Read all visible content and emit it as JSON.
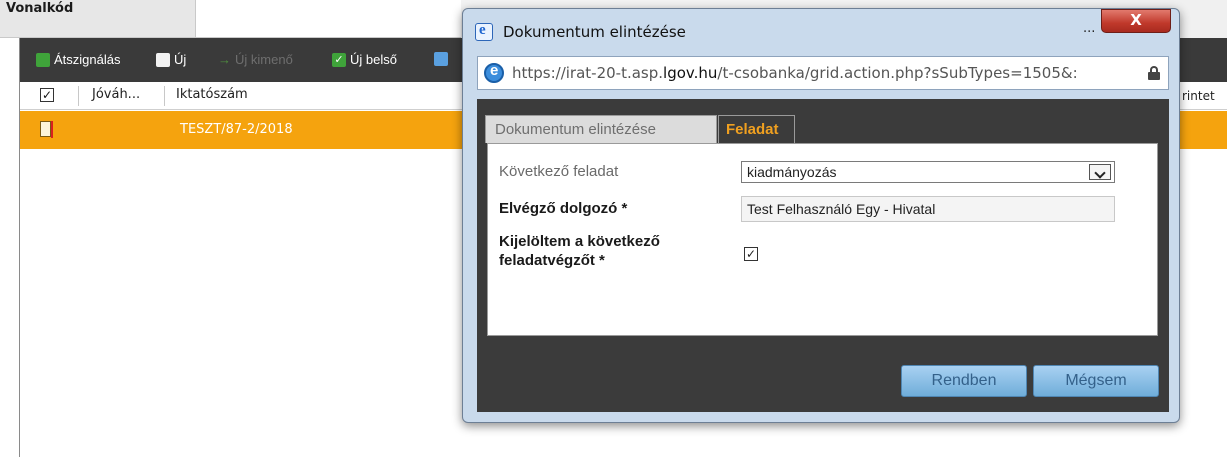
{
  "app": {
    "tab_title": "Vonalkód",
    "toolbar": {
      "items": [
        {
          "label": "Átszignálás",
          "icon": "reassign-icon",
          "enabled": true
        },
        {
          "label": "Új",
          "icon": "new-document-icon",
          "enabled": true
        },
        {
          "label": "Új kimenő",
          "icon": "outgoing-arrow-icon",
          "enabled": false
        },
        {
          "label": "Új belső",
          "icon": "check-icon",
          "enabled": true
        }
      ]
    },
    "grid": {
      "columns": [
        "Jóváh...",
        "Iktatószám"
      ],
      "right_column_fragment": "rintet",
      "rows": [
        {
          "iktatoszam": "TESZT/87-2/2018",
          "selected": true
        }
      ]
    }
  },
  "dialog": {
    "title": "Dokumentum elintézése",
    "title_dots": "...",
    "close_glyph": "X",
    "url_prefix": "https://irat-20-t.asp.",
    "url_domain": "lgov.hu",
    "url_suffix": "/t-csobanka/grid.action.php?sSubTypes=1505&:",
    "tabs": [
      {
        "label": "Dokumentum elintézése",
        "active": false
      },
      {
        "label": "Feladat",
        "active": true
      }
    ],
    "form": {
      "next_task_label": "Következő feladat",
      "next_task_value": "kiadmányozás",
      "assignee_label": "Elvégző dolgozó *",
      "assignee_value": "Test Felhasználó Egy - Hivatal",
      "selected_next_label_line1": "Kijelöltem a következő",
      "selected_next_label_line2": "feladatvégzőt *",
      "selected_next_checked": true
    },
    "buttons": {
      "ok": "Rendben",
      "cancel": "Mégsem"
    }
  },
  "colors": {
    "toolbar_bg": "#3a3a3a",
    "selected_row": "#f5a30e",
    "active_tab_text": "#f0a020",
    "dialog_frame": "#c9daec",
    "button_bg": "#8fc2e8"
  }
}
